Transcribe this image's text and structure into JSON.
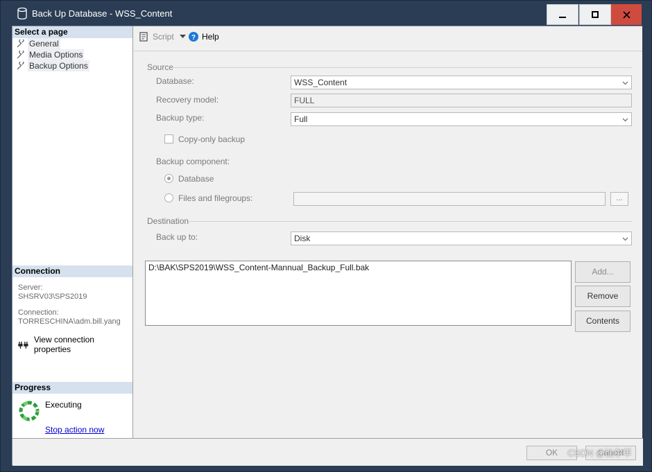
{
  "window": {
    "title": "Back Up Database - WSS_Content"
  },
  "left_panel": {
    "select_page_header": "Select a page",
    "pages": [
      {
        "label": "General"
      },
      {
        "label": "Media Options"
      },
      {
        "label": "Backup Options"
      }
    ],
    "connection_header": "Connection",
    "server_label": "Server:",
    "server_value": "SHSRV03\\SPS2019",
    "connection_label": "Connection:",
    "connection_value": "TORRESCHINA\\adm.bill.yang",
    "view_connection_properties": "View connection properties",
    "progress_header": "Progress",
    "progress_status": "Executing",
    "stop_action": "Stop action now"
  },
  "toolbar": {
    "script_label": "Script",
    "help_label": "Help"
  },
  "source": {
    "group_label": "Source",
    "database_label": "Database:",
    "database_value": "WSS_Content",
    "recovery_model_label": "Recovery model:",
    "recovery_model_value": "FULL",
    "backup_type_label": "Backup type:",
    "backup_type_value": "Full",
    "copy_only_label": "Copy-only backup",
    "copy_only_checked": false,
    "backup_component_label": "Backup component:",
    "component_database_label": "Database",
    "component_files_label": "Files and filegroups:",
    "selected_component": "Database",
    "browse_button": "..."
  },
  "destination": {
    "group_label": "Destination",
    "back_up_to_label": "Back up to:",
    "back_up_to_value": "Disk",
    "paths": [
      "D:\\BAK\\SPS2019\\WSS_Content-Mannual_Backup_Full.bak"
    ],
    "add_button": "Add...",
    "remove_button": "Remove",
    "contents_button": "Contents"
  },
  "footer": {
    "ok_button": "OK",
    "cancel_button": "Cancel",
    "watermark": "CSDN @比尔羊"
  }
}
